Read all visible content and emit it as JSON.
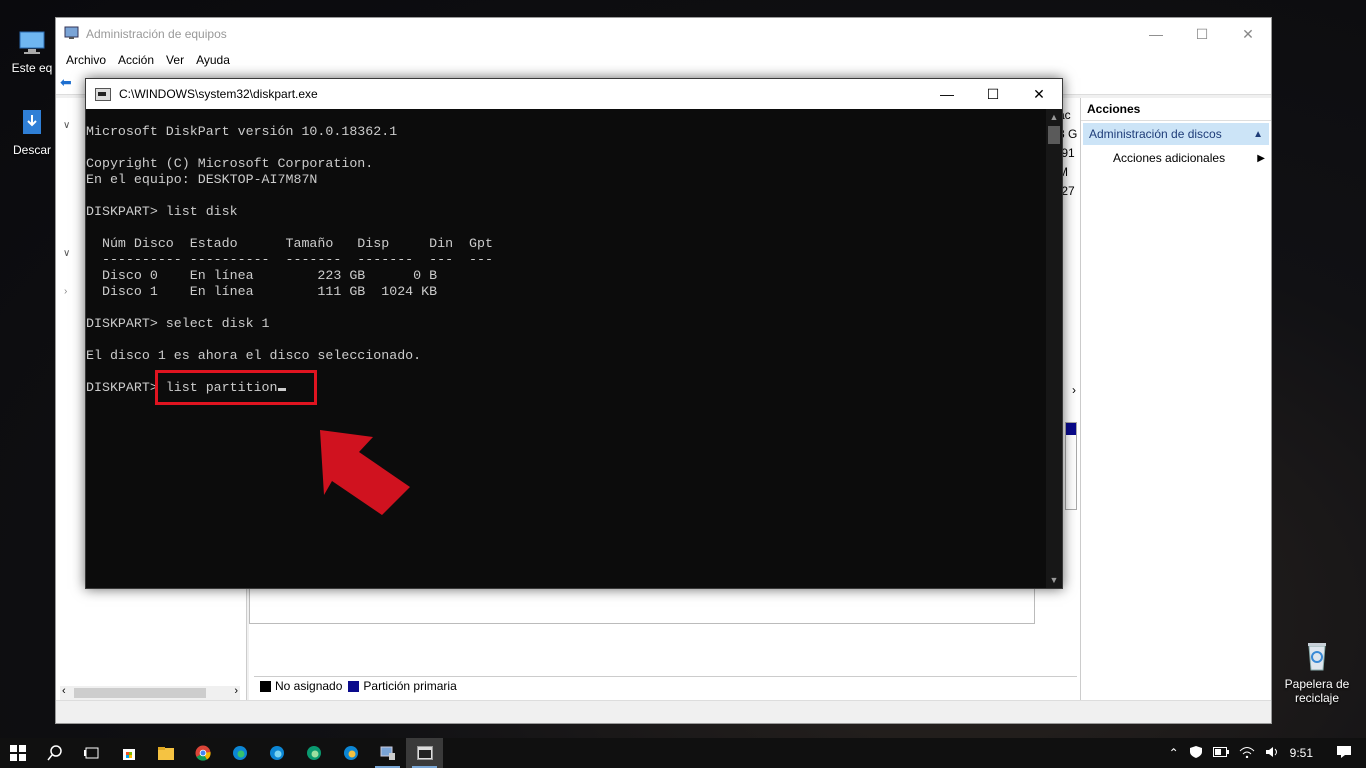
{
  "desktop": {
    "icons": [
      {
        "label": "Este eq",
        "icon": "computer-icon"
      },
      {
        "label": "Descar",
        "icon": "download-shortcut-icon"
      },
      {
        "label": "Papelera de reciclaje",
        "icon": "recycle-bin-icon"
      }
    ]
  },
  "mmc": {
    "title": "Administración de equipos",
    "menu": [
      "Archivo",
      "Acción",
      "Ver",
      "Ayuda"
    ],
    "right_peek": [
      "ac",
      "3 G",
      ",91",
      "M",
      ",27"
    ],
    "legend": [
      {
        "label": "No asignado",
        "color": "#000000"
      },
      {
        "label": "Partición primaria",
        "color": "#0a0a8c"
      }
    ],
    "actions": {
      "header": "Acciones",
      "selected": "Administración de discos",
      "item": "Acciones adicionales"
    }
  },
  "console": {
    "title": "C:\\WINDOWS\\system32\\diskpart.exe",
    "lines": [
      "Microsoft DiskPart versión 10.0.18362.1",
      "",
      "Copyright (C) Microsoft Corporation.",
      "En el equipo: DESKTOP-AI7M87N",
      "",
      "DISKPART> list disk",
      "",
      "  Núm Disco  Estado      Tamaño   Disp     Din  Gpt",
      "  ---------- ----------  -------  -------  ---  ---",
      "  Disco 0    En línea        223 GB      0 B",
      "  Disco 1    En línea        111 GB  1024 KB",
      "",
      "DISKPART> select disk 1",
      "",
      "El disco 1 es ahora el disco seleccionado.",
      ""
    ],
    "prompt": "DISKPART> ",
    "current_input": "list partition"
  },
  "annotation": {
    "color": "#e01420"
  },
  "taskbar": {
    "apps": [
      "windows-start-icon",
      "search-icon",
      "task-view-icon",
      "store-icon",
      "file-explorer-icon",
      "chrome-icon",
      "edge-icon",
      "edge-beta-icon",
      "edge-dev-icon",
      "edge-canary-icon",
      "computer-management-icon",
      "console-icon"
    ],
    "time": "9:51"
  }
}
